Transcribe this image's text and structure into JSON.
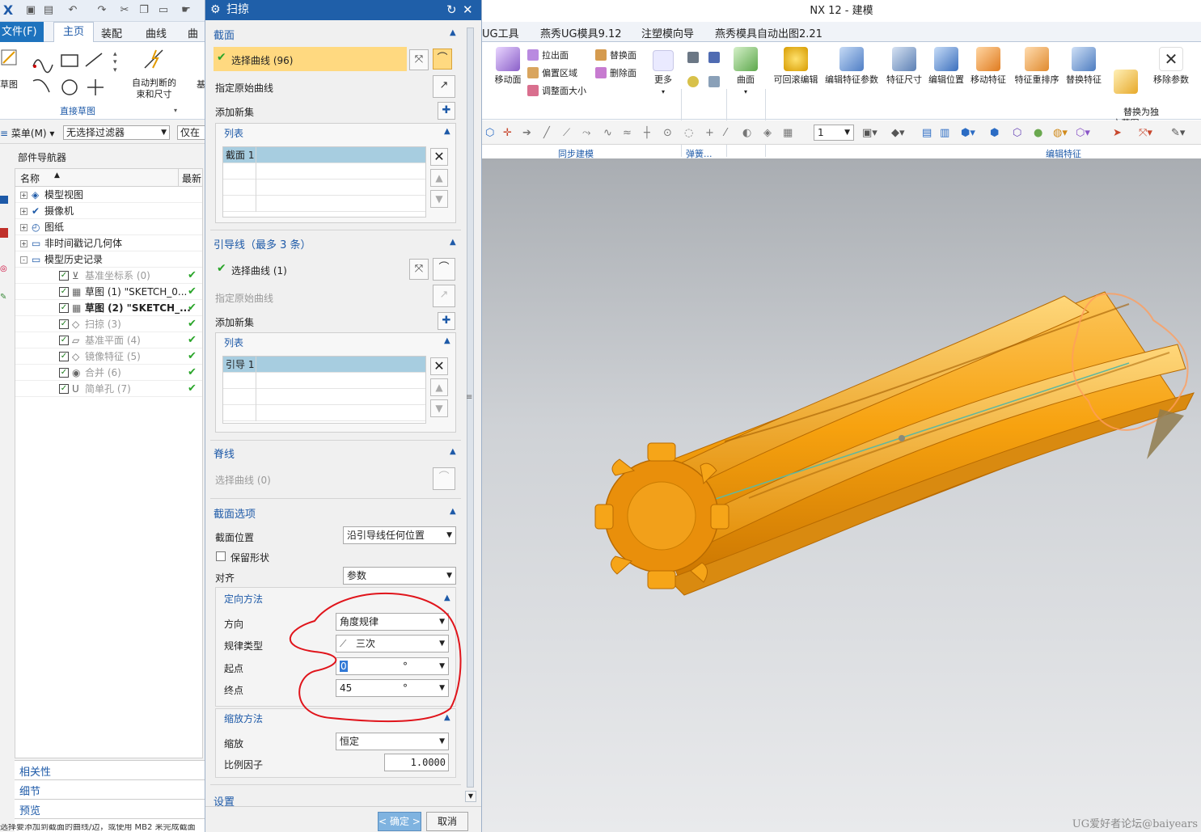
{
  "left_app": {
    "quick_access": [
      "nx-logo-icon",
      "save-icon",
      "save-all-icon",
      "undo-icon",
      "redo-icon",
      "cut-icon",
      "copy-icon",
      "paste-icon",
      "touch-mode-icon"
    ],
    "tabs": {
      "file": "文件(F)",
      "home": "主页",
      "assembly": "装配",
      "curve": "曲线",
      "more": "曲面"
    },
    "ribbon": {
      "sketch_label": "草图",
      "auto_constraint_label": "自动判断的\n束和尺寸",
      "group_direct_sketch": "直接草图",
      "partial": "基"
    },
    "filter": {
      "menu": "菜单(M)",
      "filter_select": "无选择过滤器",
      "scope_partial": "仅在工"
    },
    "navigator": {
      "title": "部件导航器",
      "col_name": "名称",
      "col_latest": "最新",
      "rows": [
        {
          "label": "模型视图",
          "level": 0,
          "expand": "+",
          "check": ""
        },
        {
          "label": "摄像机",
          "level": 0,
          "expand": "+",
          "check": ""
        },
        {
          "label": "图纸",
          "level": 0,
          "expand": "+",
          "check": ""
        },
        {
          "label": "非时间戳记几何体",
          "level": 0,
          "expand": "+",
          "check": ""
        },
        {
          "label": "模型历史记录",
          "level": 0,
          "expand": "-",
          "check": ""
        },
        {
          "label": "基准坐标系 (0)",
          "level": 1,
          "expand": "",
          "check": "✔",
          "grey": true
        },
        {
          "label": "草图 (1) \"SKETCH_0...",
          "level": 1,
          "expand": "",
          "check": "✔"
        },
        {
          "label": "草图 (2) \"SKETCH_...",
          "level": 1,
          "expand": "",
          "check": "✔",
          "bold": true
        },
        {
          "label": "扫掠 (3)",
          "level": 1,
          "expand": "",
          "check": "✔",
          "grey": true
        },
        {
          "label": "基准平面 (4)",
          "level": 1,
          "expand": "",
          "check": "✔",
          "grey": true
        },
        {
          "label": "镜像特征 (5)",
          "level": 1,
          "expand": "",
          "check": "✔",
          "grey": true
        },
        {
          "label": "合并 (6)",
          "level": 1,
          "expand": "",
          "check": "✔",
          "grey": true
        },
        {
          "label": "简单孔 (7)",
          "level": 1,
          "expand": "",
          "check": "✔",
          "grey": true
        }
      ],
      "bottom": [
        "相关性",
        "细节",
        "预览"
      ]
    },
    "status": "选择要添加到截面的曲线/边，或使用 MB2 来完成截面"
  },
  "dialog": {
    "title": "扫掠",
    "section": {
      "header": "截面",
      "select_curve": "选择曲线 (96)",
      "specify_origin": "指定原始曲线",
      "add_new_set": "添加新集",
      "list_header": "列表",
      "list_rows": [
        "截面 1"
      ]
    },
    "guides": {
      "header": "引导线（最多 3 条）",
      "select_curve": "选择曲线 (1)",
      "specify_origin": "指定原始曲线",
      "add_new_set": "添加新集",
      "list_header": "列表",
      "list_rows": [
        "引导 1"
      ]
    },
    "spine": {
      "header": "脊线",
      "select_curve": "选择曲线 (0)"
    },
    "section_options": {
      "header": "截面选项",
      "position_label": "截面位置",
      "position_value": "沿引导线任何位置",
      "preserve_shape": "保留形状",
      "align_label": "对齐",
      "align_value": "参数"
    },
    "orientation": {
      "header": "定向方法",
      "direction_label": "方向",
      "direction_value": "角度规律",
      "law_type_label": "规律类型",
      "law_type_value": "三次",
      "start_label": "起点",
      "start_value": "0",
      "end_label": "终点",
      "end_value": "45",
      "unit": "°"
    },
    "scaling": {
      "header": "缩放方法",
      "scale_label": "缩放",
      "scale_value": "恒定",
      "factor_label": "比例因子",
      "factor_value": "1.0000"
    },
    "settings_header": "设置",
    "ok_button": "< 确定 >",
    "cancel_button": "取消"
  },
  "right_app": {
    "window_title": "NX 12 - 建模",
    "tabs": [
      "UG工具",
      "燕秀UG模具9.12",
      "注塑模向导",
      "燕秀模具自动出图2.21"
    ],
    "ribbon": {
      "move_face": "移动面",
      "pull_face": "拉出面",
      "offset_region": "偏置区域",
      "resize_face": "调整面大小",
      "replace_face": "替换面",
      "delete_face": "删除面",
      "more": "更多",
      "surface": "曲面",
      "rollback_edit": "可回滚编辑",
      "edit_feature_params": "编辑特征参数",
      "feature_dimension": "特征尺寸",
      "edit_position": "编辑位置",
      "move_feature": "移动特征",
      "reorder_feature": "特征重排序",
      "replace_feature": "替换特征",
      "replace_independent_sketch": "替换为独\n立草图",
      "remove_params": "移除参数",
      "group_sync": "同步建模",
      "group_spring": "弹簧...",
      "group_edit_feature": "编辑特征"
    },
    "toolbar_layer_value": "1",
    "watermark": "UG爱好者论坛@baiyears"
  },
  "colors": {
    "title_blue": "#1f5fa9",
    "select_highlight": "#ffd980",
    "list_selected": "#a7cde0",
    "part_orange": "#f7a20f",
    "annotation_red": "#e0141b",
    "check_green": "#2aa52a"
  }
}
